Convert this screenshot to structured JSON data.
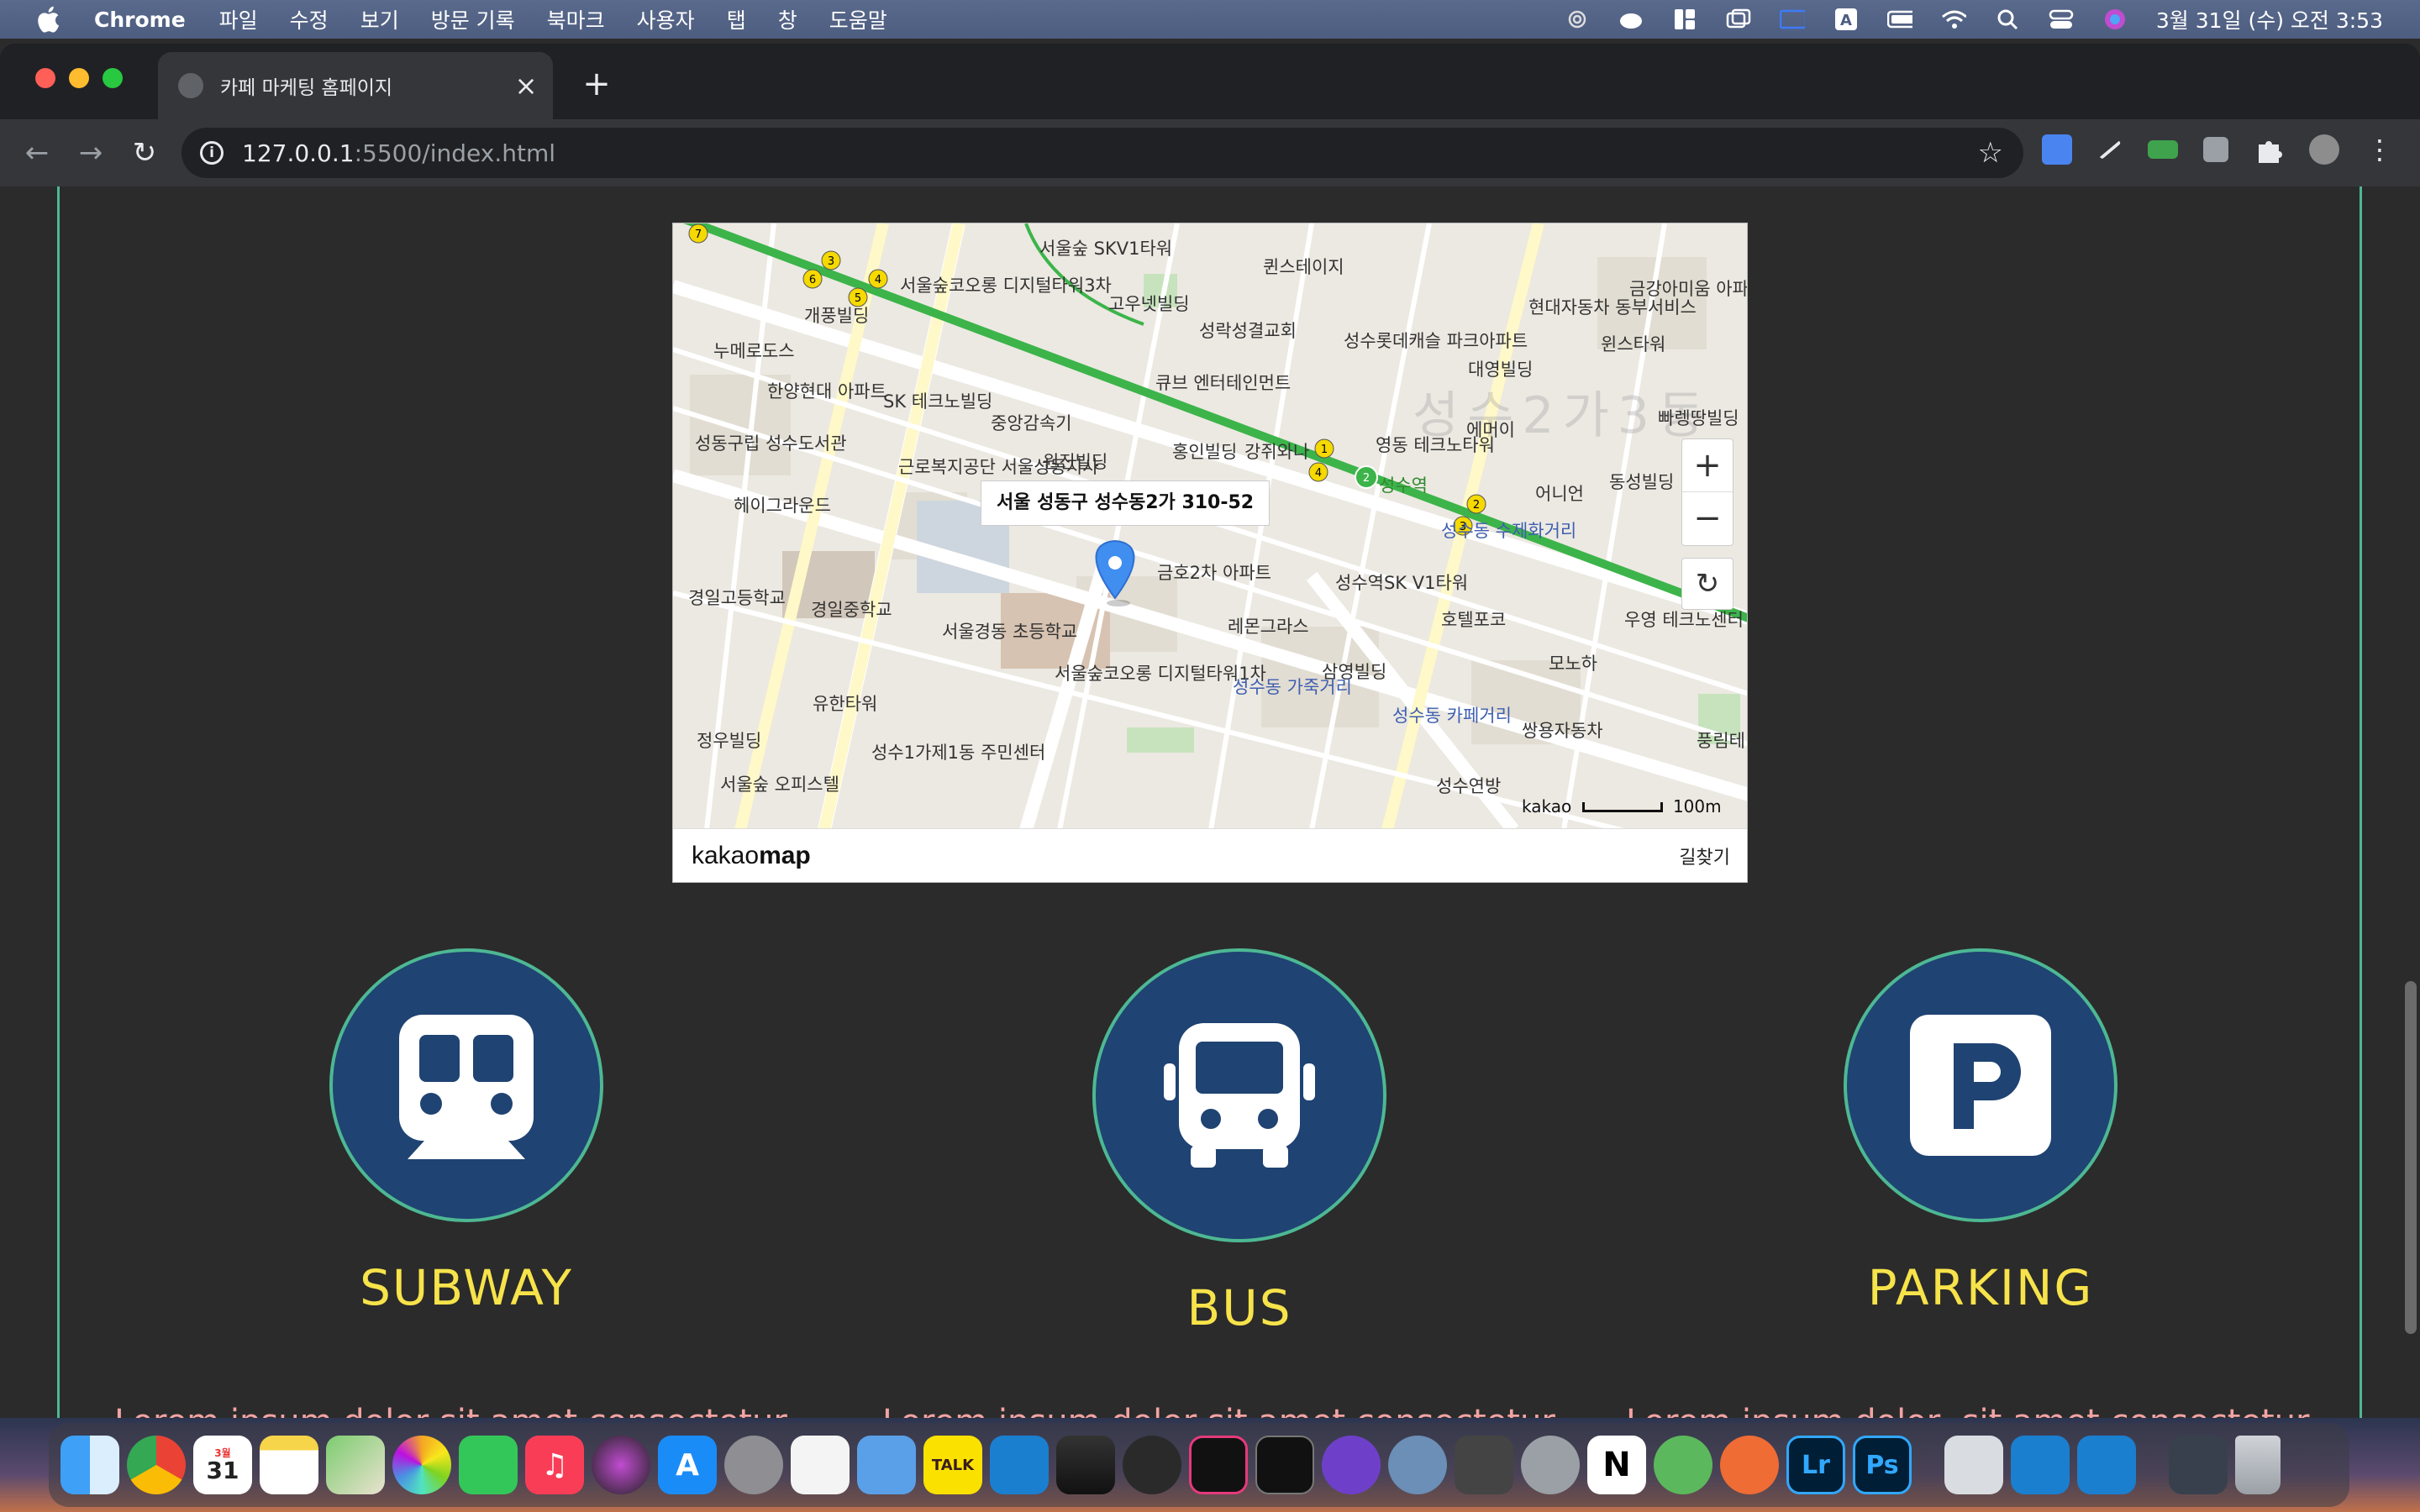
{
  "menubar": {
    "app_name": "Chrome",
    "items": [
      "파일",
      "수정",
      "보기",
      "방문 기록",
      "북마크",
      "사용자",
      "탭",
      "창",
      "도움말"
    ],
    "clock": "3월 31일 (수) 오전 3:53",
    "status_icons": [
      "cloud-icon",
      "user-icon",
      "widgets-icon",
      "screen-mirror-icon",
      "display-icon",
      "input-a-icon",
      "battery-icon",
      "wifi-icon",
      "search-icon",
      "control-center-icon",
      "siri-icon"
    ]
  },
  "browser": {
    "tab_title": "카페 마케팅 홈페이지",
    "url_host": "127.0.0.1",
    "url_path": ":5500/index.html",
    "new_tab_label": "+",
    "close_label": "×"
  },
  "map": {
    "address": "서울 성동구 성수동2가 310-52",
    "brand_light": "kakao",
    "brand_bold": "map",
    "directions": "길찾기",
    "zoom_in": "+",
    "zoom_out": "−",
    "reset": "↻",
    "scale_logo": "kakao",
    "scale_label": "100m",
    "watermark": "성수2가3동",
    "labels": [
      "서울숲 SKV1타워",
      "퀸스테이지",
      "서울숲코오롱 디지털타워3차",
      "고우넷빌딩",
      "개풍빌딩",
      "성락성결교회",
      "누메로도스",
      "한양현대 아파트",
      "SK 테크노빌딩",
      "중앙감속기",
      "큐브 엔터테인먼트",
      "성수롯데캐슬 파크아파트",
      "대영빌딩",
      "현대자동차 동부서비스",
      "금강아미움 아파트",
      "윈스타워",
      "성동구립 성수도서관",
      "근로복지공단 서울성동지사",
      "원진빌딩",
      "홍인빌딩",
      "강쥐와나",
      "영동 테크노타워",
      "에머이",
      "빠렝땅빌딩",
      "헤이그라운드",
      "성수역",
      "어니언",
      "동성빌딩",
      "성수동 수제화거리",
      "경일고등학교",
      "경일중학교",
      "금호2차 아파트",
      "성수역SK V1타워",
      "레몬그라스",
      "호텔포코",
      "우영 테크노센터",
      "서울경동 초등학교",
      "서울숲코오롱 디지털타워1차",
      "삼영빌딩",
      "모노하",
      "성수동 가죽거리",
      "성수동 카페거리",
      "유한타워",
      "정우빌딩",
      "성수1가제1동 주민센터",
      "쌍용자동차",
      "풍림테",
      "서울숲 오피스텔",
      "성수연방"
    ]
  },
  "features": [
    {
      "title": "SUBWAY",
      "icon": "subway-icon",
      "desc": "Lorem ipsum dolor sit amet consectetur"
    },
    {
      "title": "BUS",
      "icon": "bus-icon",
      "desc": "Lorem ipsum dolor sit amet consectetur,"
    },
    {
      "title": "PARKING",
      "icon": "parking-icon",
      "desc": "Lorem ipsum dolor, sit amet consectetur"
    }
  ],
  "colors": {
    "accent_green": "#4db893",
    "title_yellow": "#f7e34a",
    "circle_blue": "#1f4372",
    "desc_pink": "#f2a3a3",
    "marker_blue": "#3f8ef0"
  },
  "dock": {
    "calendar_month": "3월",
    "calendar_day": "31",
    "talk_label": "TALK",
    "lr_label": "Lr",
    "ps_label": "Ps",
    "notion_label": "N",
    "apps": [
      "finder-icon",
      "chrome-icon",
      "calendar-icon",
      "notes-icon",
      "maps-icon",
      "photos-icon",
      "facetime-icon",
      "music-icon",
      "siri-icon",
      "app-store-icon",
      "system-preferences-icon",
      "textedit-icon",
      "files-icon",
      "kakaotalk-icon",
      "vscode-icon",
      "final-cut-icon",
      "davinci-icon",
      "iterm-icon",
      "terminal-icon",
      "github-icon",
      "safari-icon",
      "xcode-icon",
      "quicktime-icon",
      "notion-icon",
      "atom-icon",
      "postman-icon",
      "lightroom-icon",
      "photoshop-icon",
      "preview-icon",
      "vscode-icon-2",
      "vscode-icon-3",
      "finder-window-icon",
      "trash-icon"
    ]
  }
}
